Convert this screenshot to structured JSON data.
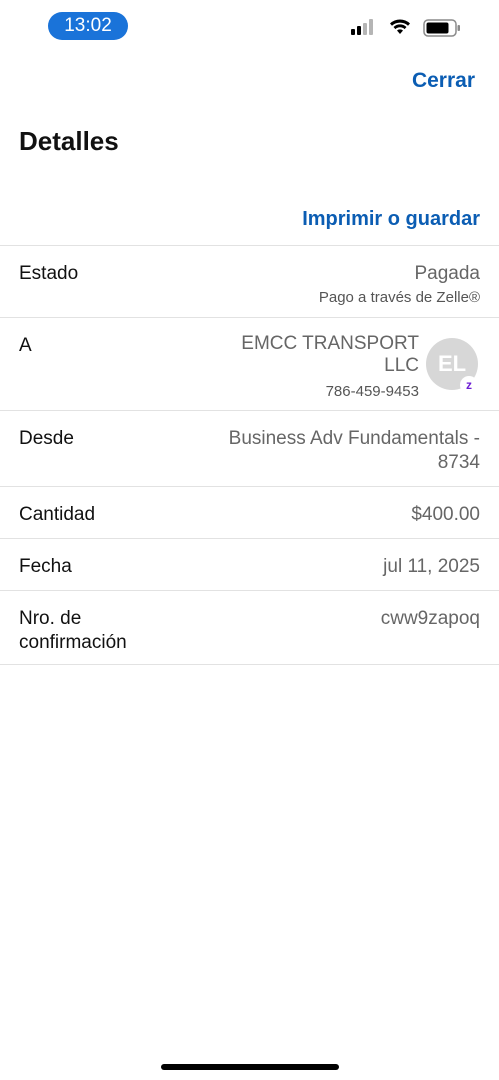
{
  "status_bar": {
    "time": "13:02",
    "icons": [
      "signal-icon",
      "wifi-icon",
      "battery-icon"
    ]
  },
  "header": {
    "close_label": "Cerrar",
    "title": "Detalles",
    "print_label": "Imprimir o guardar"
  },
  "details": {
    "estado": {
      "label": "Estado",
      "value": "Pagada",
      "sub": "Pago a través de Zelle®"
    },
    "a": {
      "label": "A",
      "name_line1": "EMCC TRANSPORT",
      "name_line2": "LLC",
      "phone": "786-459-9453",
      "avatar_initials": "EL",
      "badge": "z"
    },
    "desde": {
      "label": "Desde",
      "value_line1": "Business Adv Fundamentals -",
      "value_line2": "8734"
    },
    "cantidad": {
      "label": "Cantidad",
      "value": "$400.00"
    },
    "fecha": {
      "label": "Fecha",
      "value": "jul 11, 2025"
    },
    "nro": {
      "label_line1": "Nro. de",
      "label_line2": "confirmación",
      "value": "cww9zapoq"
    }
  },
  "colors": {
    "accent": "#0b5db3",
    "time_pill": "#1a73d9",
    "zelle": "#6d1ed4"
  }
}
